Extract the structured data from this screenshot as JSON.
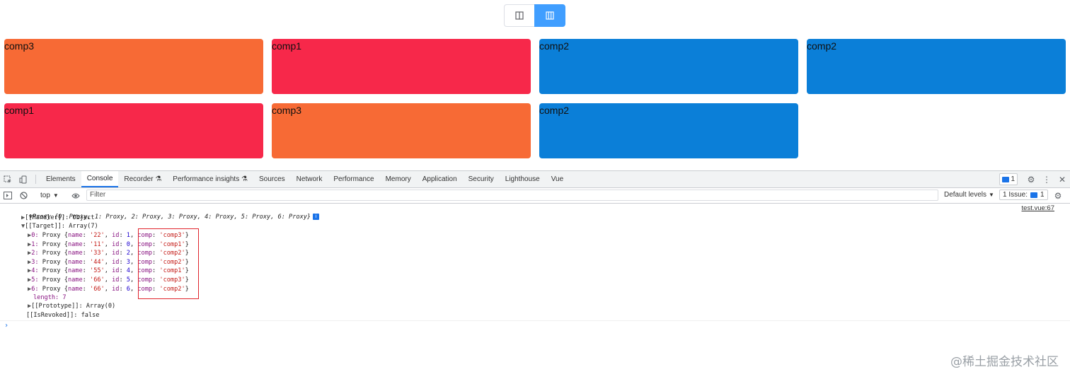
{
  "colors": {
    "comp1": "#f7284a",
    "comp2": "#0b7fd8",
    "comp3": "#f76a35",
    "toggle_active": "#409eff",
    "highlight_box": "#e0242c"
  },
  "toggle": {
    "left_icon": "single-column-layout-icon",
    "right_icon": "multi-column-layout-icon"
  },
  "cards": [
    {
      "label": "comp3",
      "comp": "comp3"
    },
    {
      "label": "comp1",
      "comp": "comp1"
    },
    {
      "label": "comp2",
      "comp": "comp2"
    },
    {
      "label": "comp2",
      "comp": "comp2"
    },
    {
      "label": "comp1",
      "comp": "comp1"
    },
    {
      "label": "comp3",
      "comp": "comp3"
    },
    {
      "label": "comp2",
      "comp": "comp2"
    }
  ],
  "devtools": {
    "tabs": [
      "Elements",
      "Console",
      "Recorder",
      "Performance insights",
      "Sources",
      "Network",
      "Performance",
      "Memory",
      "Application",
      "Security",
      "Lighthouse",
      "Vue"
    ],
    "active_tab": "Console",
    "message_count": "1",
    "context": "top",
    "filter_placeholder": "Filter",
    "levels": "Default levels",
    "issues": "1 Issue:",
    "issues_count": "1"
  },
  "console": {
    "source_link": "test.vue:67",
    "header": "Proxy {0: Proxy, 1: Proxy, 2: Proxy, 3: Proxy, 4: Proxy, 5: Proxy, 6: Proxy}",
    "handler": "[[Handler]]: Object",
    "target": "[[Target]]: Array(7)",
    "items": [
      {
        "idx": "0",
        "name": "'22'",
        "id": "1",
        "comp": "'comp3'"
      },
      {
        "idx": "1",
        "name": "'11'",
        "id": "0",
        "comp": "'comp1'"
      },
      {
        "idx": "2",
        "name": "'33'",
        "id": "2",
        "comp": "'comp2'"
      },
      {
        "idx": "3",
        "name": "'44'",
        "id": "3",
        "comp": "'comp2'"
      },
      {
        "idx": "4",
        "name": "'55'",
        "id": "4",
        "comp": "'comp1'"
      },
      {
        "idx": "5",
        "name": "'66'",
        "id": "5",
        "comp": "'comp3'"
      },
      {
        "idx": "6",
        "name": "'66'",
        "id": "6",
        "comp": "'comp2'"
      }
    ],
    "length_line": "length: 7",
    "prototype_line": "[[Prototype]]: Array(0)",
    "revoked_line": "[[IsRevoked]]: false",
    "prompt": "›"
  },
  "watermark": "@稀土掘金技术社区"
}
